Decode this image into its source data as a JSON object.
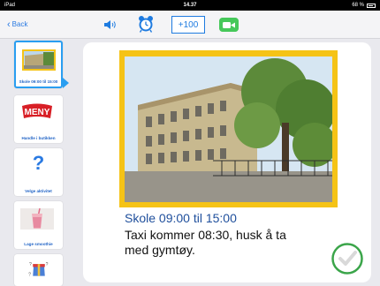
{
  "status_bar": {
    "device": "iPad",
    "time": "14.37",
    "battery": "68 %"
  },
  "toolbar": {
    "back_label": "Back",
    "plus_button_label": "+100",
    "icons": [
      "speaker-icon",
      "alarm-clock-icon",
      "facetime-icon"
    ]
  },
  "sidebar": {
    "items": [
      {
        "label": "Skole 09:00 til 15:00",
        "selected": true,
        "icon": "school-photo"
      },
      {
        "label": "Handle i butikken",
        "selected": false,
        "icon": "meny-logo",
        "logo_text": "MENY"
      },
      {
        "label": "Velge aktivitet",
        "selected": false,
        "icon": "question-mark-icon",
        "glyph": "?"
      },
      {
        "label": "Lage smoothie",
        "selected": false,
        "icon": "smoothie-photo"
      },
      {
        "label": "",
        "selected": false,
        "icon": "gift-box-icon"
      }
    ]
  },
  "detail": {
    "title": "Skole 09:00 til 15:00",
    "description": "Taxi kommer 08:30, husk å ta med gymtøy.",
    "frame_color": "#f5c316",
    "complete_icon": "checkmark-circle-icon"
  },
  "colors": {
    "accent": "#1e7be0",
    "title": "#1f4f9c",
    "check": "#3ba54a"
  }
}
